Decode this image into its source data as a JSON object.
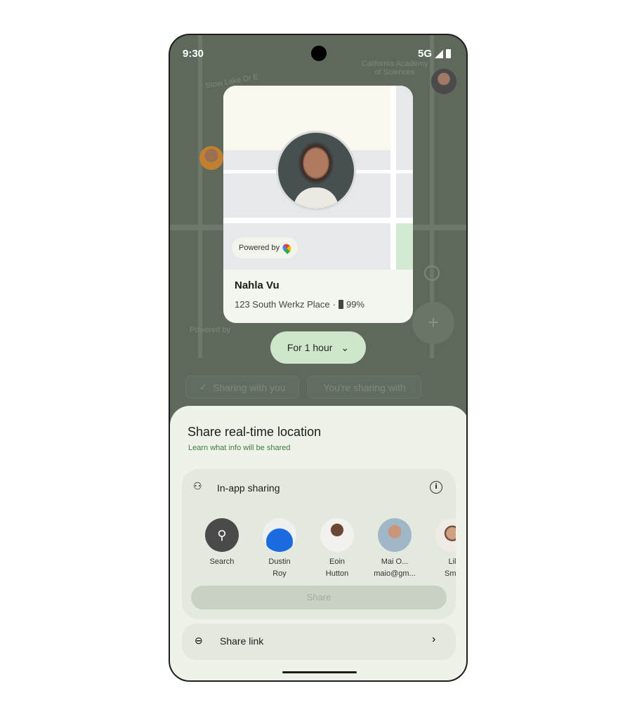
{
  "status_bar": {
    "time": "9:30",
    "network": "5G"
  },
  "map": {
    "labels": [
      "California Academy of Sciences",
      "Stow Lake Dr E",
      "Powered by"
    ]
  },
  "card": {
    "powered_by": "Powered by",
    "name": "Nahla Vu",
    "address": "123 South Werkz Place",
    "separator": "·",
    "battery": "99%"
  },
  "duration_chip": {
    "label": "For 1 hour"
  },
  "tabs": [
    {
      "label": "Sharing with you",
      "selected": true
    },
    {
      "label": "You're sharing with",
      "selected": false
    }
  ],
  "sheet": {
    "title": "Share real-time location",
    "learn_link": "Learn what info will be shared",
    "in_app": {
      "title": "In-app sharing",
      "contacts": [
        {
          "line1": "Search",
          "line2": ""
        },
        {
          "line1": "Dustin",
          "line2": "Roy"
        },
        {
          "line1": "Eoin",
          "line2": "Hutton"
        },
        {
          "line1": "Mai O...",
          "line2": "maio@gm..."
        },
        {
          "line1": "Lil",
          "line2": "Smy"
        }
      ],
      "share_button": "Share"
    },
    "share_link": "Share link"
  },
  "colors": {
    "accent": "#cfe6cc",
    "link": "#3f7d3b",
    "sheet": "#eef2e8"
  }
}
